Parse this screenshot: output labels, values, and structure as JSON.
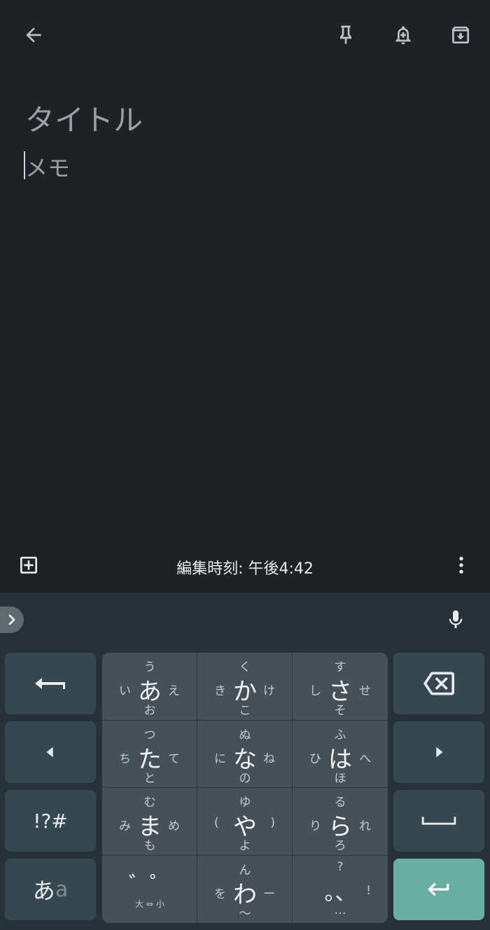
{
  "editor": {
    "title_placeholder": "タイトル",
    "note_placeholder": "メモ"
  },
  "footer": {
    "edited_text": "編集時刻: 午後4:42"
  },
  "keyboard": {
    "symbols_label": "!?#",
    "mode_main": "あ",
    "mode_sub": "a",
    "grid": [
      {
        "main": "あ",
        "u": "う",
        "l": "い",
        "r": "え",
        "o": "お"
      },
      {
        "main": "か",
        "u": "く",
        "l": "き",
        "r": "け",
        "o": "こ"
      },
      {
        "main": "さ",
        "u": "す",
        "l": "し",
        "r": "せ",
        "o": "そ"
      },
      {
        "main": "た",
        "u": "つ",
        "l": "ち",
        "r": "て",
        "o": "と"
      },
      {
        "main": "な",
        "u": "ぬ",
        "l": "に",
        "r": "ね",
        "o": "の"
      },
      {
        "main": "は",
        "u": "ふ",
        "l": "ひ",
        "r": "へ",
        "o": "ほ"
      },
      {
        "main": "ま",
        "u": "む",
        "l": "み",
        "r": "め",
        "o": "も"
      },
      {
        "main": "や",
        "u": "ゆ",
        "l": "(",
        "r": ")",
        "o": "よ"
      },
      {
        "main": "ら",
        "u": "る",
        "l": "り",
        "r": "れ",
        "o": "ろ"
      },
      {
        "main": "゛゜",
        "u": "",
        "l": "",
        "r": "",
        "o": "",
        "tag": "大 ⇔ 小"
      },
      {
        "main": "わ",
        "u": "ん",
        "l": "を",
        "r": "ー",
        "o": "〜"
      },
      {
        "main": "。、",
        "u": "?",
        "l": "",
        "r": "!",
        "o": "…"
      }
    ]
  },
  "colors": {
    "background": "#202124",
    "keyboard": "#263238",
    "key": "#37474f",
    "enter": "#6aada3"
  }
}
